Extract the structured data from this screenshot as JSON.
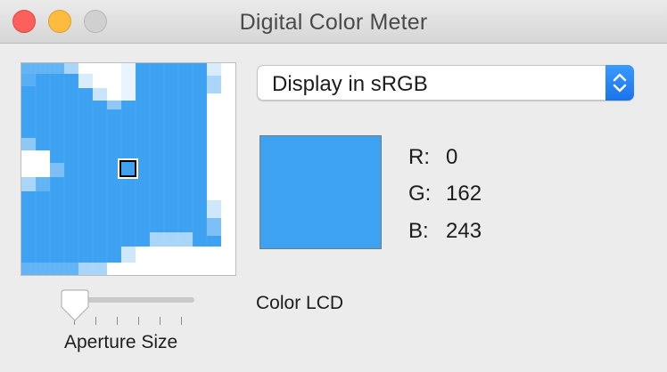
{
  "window": {
    "title": "Digital Color Meter"
  },
  "magnifier": {
    "sampled_color": "#3ea2f3"
  },
  "display_menu": {
    "selected": "Display in sRGB"
  },
  "color": {
    "swatch": "#3ea2f3",
    "r_label": "R:",
    "r_value": "0",
    "g_label": "G:",
    "g_value": "162",
    "b_label": "B:",
    "b_value": "243"
  },
  "aperture": {
    "label": "Aperture Size",
    "level": 0
  },
  "display_name": "Color LCD",
  "icons": [
    "close-icon",
    "minimize-icon",
    "zoom-icon",
    "popup-stepper-icon",
    "aperture-reticle-icon"
  ]
}
